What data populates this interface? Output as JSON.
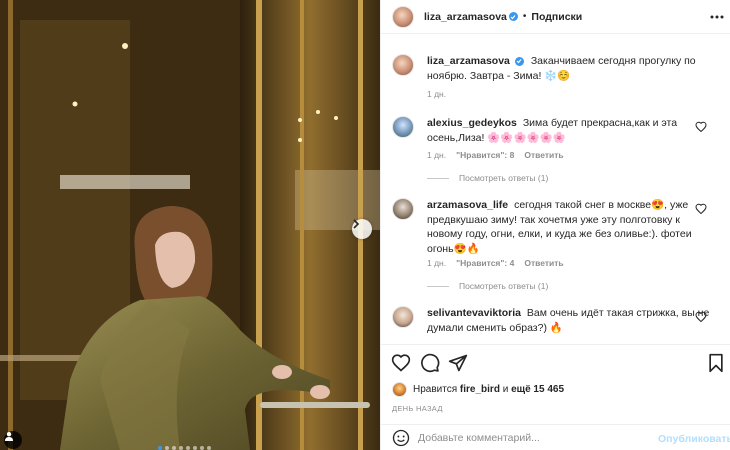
{
  "header": {
    "username": "liza_arzamasova",
    "separator": "•",
    "follow_label": "Подписки",
    "avatar_icon": "user-avatar",
    "verified_icon": "verified-badge-icon",
    "more_icon": "more-horizontal-icon"
  },
  "caption": {
    "username": "liza_arzamasova",
    "text": "Заканчиваем сегодня прогулку по ноябрю. Завтра - Зима! ❄️☺️",
    "time": "1 дн."
  },
  "comments": [
    {
      "username": "alexius_gedeykos",
      "text": "Зима будет прекрасна,как и эта осень,Лиза! 🌸🌸🌸🌸🌸🌸",
      "time": "1 дн.",
      "likes": "\"Нравится\": 8",
      "reply_label": "Ответить",
      "view_replies": "Посмотреть ответы (1)"
    },
    {
      "username": "arzamasova_life",
      "text": "сегодня такой снег в москве😍, уже предвкушаю зиму! так хочетмя уже эту полготовку к новому году, огни, елки, и куда же без оливье:). фотеи огонь😍🔥",
      "time": "1 дн.",
      "likes": "\"Нравится\": 4",
      "reply_label": "Ответить",
      "view_replies": "Посмотреть ответы (1)"
    },
    {
      "username": "selivantevaviktoria",
      "text": "Вам очень идёт такая стрижка, вы не думали сменить образ?) 🔥"
    }
  ],
  "actions": {
    "like_icon": "heart-icon",
    "comment_icon": "comment-icon",
    "share_icon": "share-icon",
    "save_icon": "bookmark-icon"
  },
  "likes": {
    "prefix": "Нравится",
    "user": "fire_bird",
    "middle": "и",
    "count": "ещё 15 465"
  },
  "date": "ДЕНЬ НАЗАД",
  "add_comment": {
    "emoji_icon": "emoji-icon",
    "placeholder": "Добавьте комментарий...",
    "publish_label": "Опубликовать"
  },
  "colors": {
    "accent": "#3897f0",
    "publish_disabled": "#b2dffc",
    "muted": "#8e8e8e"
  }
}
